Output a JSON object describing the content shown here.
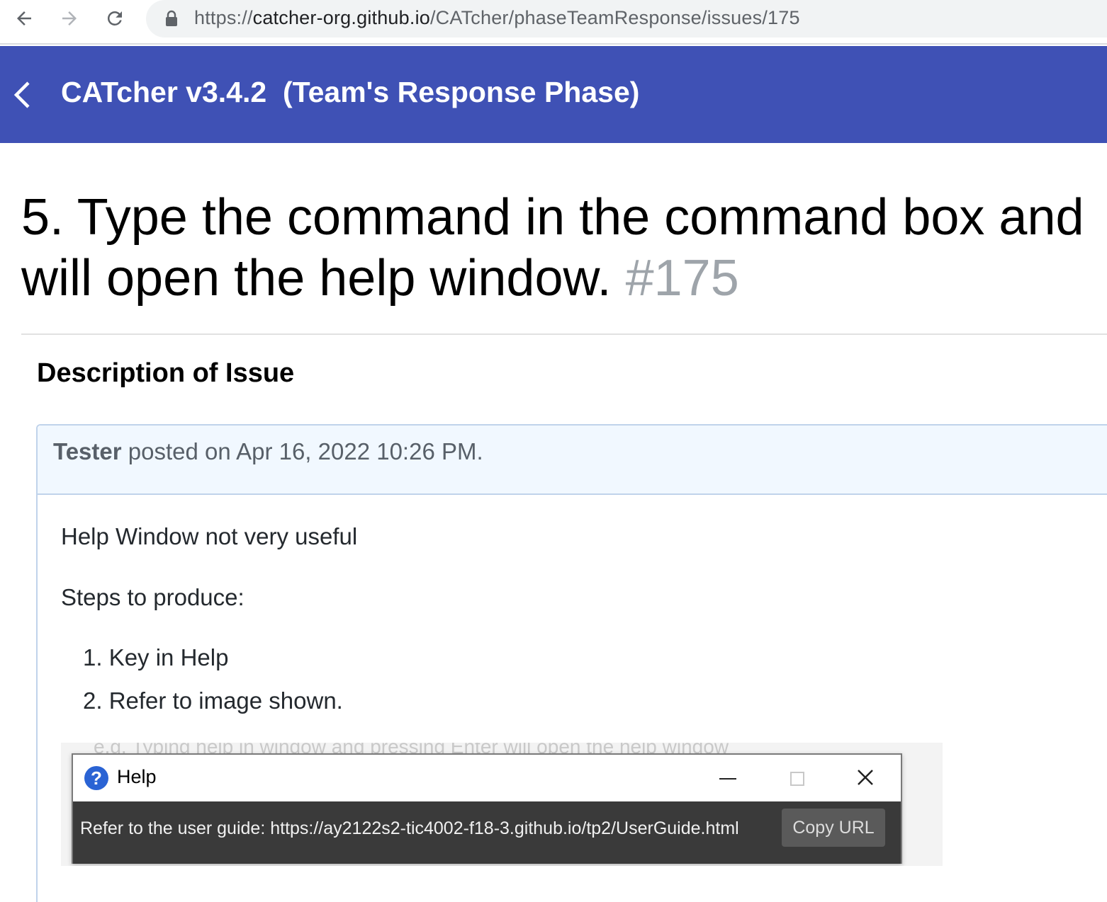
{
  "browser": {
    "url_prefix": "https://",
    "url_host": "catcher-org.github.io",
    "url_path": "/CATcher/phaseTeamResponse/issues/175"
  },
  "header": {
    "title": "CATcher v3.4.2  (Team's Response Phase)"
  },
  "issue": {
    "title_line1": "5. Type the command in the command box and",
    "title_line2": "will open the help window.",
    "number": "#175"
  },
  "section": {
    "heading": "Description of Issue"
  },
  "comment": {
    "author": "Tester",
    "posted_text": " posted on Apr 16, 2022 10:26 PM.",
    "body_line1": "Help Window not very useful",
    "body_line2": "Steps to produce:",
    "steps": [
      "1. Key in Help",
      "2. Refer to image shown."
    ]
  },
  "screenshot": {
    "faint_text": "e.g. Typing help in window and pressing Enter will open the help window",
    "window_title": "Help",
    "help_text": "Refer to the user guide: https://ay2122s2-tic4002-f18-3.github.io/tp2/UserGuide.html",
    "copy_button": "Copy URL"
  },
  "colors": {
    "header_bg": "#3f51b5",
    "comment_header_bg": "#f1f8ff",
    "issue_number": "#9ea4aa"
  },
  "icons": [
    "arrow-left-icon",
    "arrow-right-icon",
    "reload-icon",
    "lock-icon",
    "chevron-left-icon",
    "help-question-icon",
    "minimize-icon",
    "maximize-icon",
    "close-icon"
  ]
}
